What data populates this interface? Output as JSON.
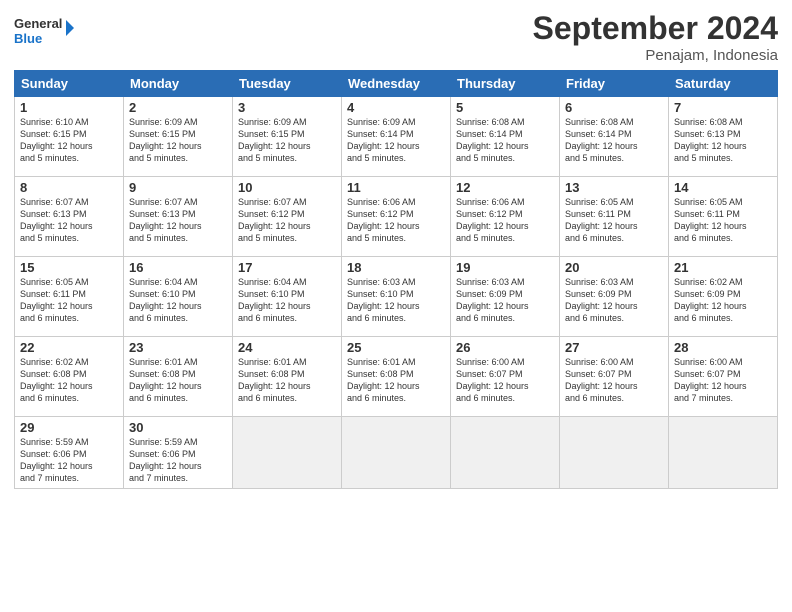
{
  "logo": {
    "line1": "General",
    "line2": "Blue"
  },
  "title": "September 2024",
  "location": "Penajam, Indonesia",
  "days_header": [
    "Sunday",
    "Monday",
    "Tuesday",
    "Wednesday",
    "Thursday",
    "Friday",
    "Saturday"
  ],
  "weeks": [
    [
      {
        "day": "1",
        "text": "Sunrise: 6:10 AM\nSunset: 6:15 PM\nDaylight: 12 hours\nand 5 minutes."
      },
      {
        "day": "2",
        "text": "Sunrise: 6:09 AM\nSunset: 6:15 PM\nDaylight: 12 hours\nand 5 minutes."
      },
      {
        "day": "3",
        "text": "Sunrise: 6:09 AM\nSunset: 6:15 PM\nDaylight: 12 hours\nand 5 minutes."
      },
      {
        "day": "4",
        "text": "Sunrise: 6:09 AM\nSunset: 6:14 PM\nDaylight: 12 hours\nand 5 minutes."
      },
      {
        "day": "5",
        "text": "Sunrise: 6:08 AM\nSunset: 6:14 PM\nDaylight: 12 hours\nand 5 minutes."
      },
      {
        "day": "6",
        "text": "Sunrise: 6:08 AM\nSunset: 6:14 PM\nDaylight: 12 hours\nand 5 minutes."
      },
      {
        "day": "7",
        "text": "Sunrise: 6:08 AM\nSunset: 6:13 PM\nDaylight: 12 hours\nand 5 minutes."
      }
    ],
    [
      {
        "day": "8",
        "text": "Sunrise: 6:07 AM\nSunset: 6:13 PM\nDaylight: 12 hours\nand 5 minutes."
      },
      {
        "day": "9",
        "text": "Sunrise: 6:07 AM\nSunset: 6:13 PM\nDaylight: 12 hours\nand 5 minutes."
      },
      {
        "day": "10",
        "text": "Sunrise: 6:07 AM\nSunset: 6:12 PM\nDaylight: 12 hours\nand 5 minutes."
      },
      {
        "day": "11",
        "text": "Sunrise: 6:06 AM\nSunset: 6:12 PM\nDaylight: 12 hours\nand 5 minutes."
      },
      {
        "day": "12",
        "text": "Sunrise: 6:06 AM\nSunset: 6:12 PM\nDaylight: 12 hours\nand 5 minutes."
      },
      {
        "day": "13",
        "text": "Sunrise: 6:05 AM\nSunset: 6:11 PM\nDaylight: 12 hours\nand 6 minutes."
      },
      {
        "day": "14",
        "text": "Sunrise: 6:05 AM\nSunset: 6:11 PM\nDaylight: 12 hours\nand 6 minutes."
      }
    ],
    [
      {
        "day": "15",
        "text": "Sunrise: 6:05 AM\nSunset: 6:11 PM\nDaylight: 12 hours\nand 6 minutes."
      },
      {
        "day": "16",
        "text": "Sunrise: 6:04 AM\nSunset: 6:10 PM\nDaylight: 12 hours\nand 6 minutes."
      },
      {
        "day": "17",
        "text": "Sunrise: 6:04 AM\nSunset: 6:10 PM\nDaylight: 12 hours\nand 6 minutes."
      },
      {
        "day": "18",
        "text": "Sunrise: 6:03 AM\nSunset: 6:10 PM\nDaylight: 12 hours\nand 6 minutes."
      },
      {
        "day": "19",
        "text": "Sunrise: 6:03 AM\nSunset: 6:09 PM\nDaylight: 12 hours\nand 6 minutes."
      },
      {
        "day": "20",
        "text": "Sunrise: 6:03 AM\nSunset: 6:09 PM\nDaylight: 12 hours\nand 6 minutes."
      },
      {
        "day": "21",
        "text": "Sunrise: 6:02 AM\nSunset: 6:09 PM\nDaylight: 12 hours\nand 6 minutes."
      }
    ],
    [
      {
        "day": "22",
        "text": "Sunrise: 6:02 AM\nSunset: 6:08 PM\nDaylight: 12 hours\nand 6 minutes."
      },
      {
        "day": "23",
        "text": "Sunrise: 6:01 AM\nSunset: 6:08 PM\nDaylight: 12 hours\nand 6 minutes."
      },
      {
        "day": "24",
        "text": "Sunrise: 6:01 AM\nSunset: 6:08 PM\nDaylight: 12 hours\nand 6 minutes."
      },
      {
        "day": "25",
        "text": "Sunrise: 6:01 AM\nSunset: 6:08 PM\nDaylight: 12 hours\nand 6 minutes."
      },
      {
        "day": "26",
        "text": "Sunrise: 6:00 AM\nSunset: 6:07 PM\nDaylight: 12 hours\nand 6 minutes."
      },
      {
        "day": "27",
        "text": "Sunrise: 6:00 AM\nSunset: 6:07 PM\nDaylight: 12 hours\nand 6 minutes."
      },
      {
        "day": "28",
        "text": "Sunrise: 6:00 AM\nSunset: 6:07 PM\nDaylight: 12 hours\nand 7 minutes."
      }
    ],
    [
      {
        "day": "29",
        "text": "Sunrise: 5:59 AM\nSunset: 6:06 PM\nDaylight: 12 hours\nand 7 minutes."
      },
      {
        "day": "30",
        "text": "Sunrise: 5:59 AM\nSunset: 6:06 PM\nDaylight: 12 hours\nand 7 minutes."
      },
      {
        "day": "",
        "text": "",
        "empty": true
      },
      {
        "day": "",
        "text": "",
        "empty": true
      },
      {
        "day": "",
        "text": "",
        "empty": true
      },
      {
        "day": "",
        "text": "",
        "empty": true
      },
      {
        "day": "",
        "text": "",
        "empty": true
      }
    ]
  ]
}
